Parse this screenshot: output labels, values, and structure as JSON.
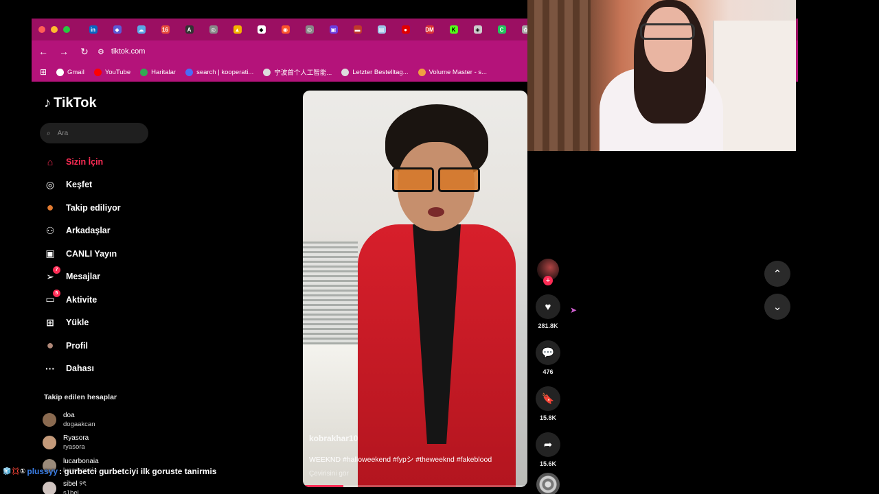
{
  "browser": {
    "url": "tiktok.com",
    "traffic_colors": [
      "#ff5f57",
      "#febc2e",
      "#28c840"
    ],
    "tab_favicons": [
      {
        "name": "linkedin-tab-icon",
        "color": "#0a66c2",
        "glyph": "in"
      },
      {
        "name": "app-tab-icon",
        "color": "#5b5bd6",
        "glyph": "◆"
      },
      {
        "name": "cloud-tab-icon",
        "color": "#5aa9e6",
        "glyph": "☁"
      },
      {
        "name": "calendar-tab-icon",
        "color": "#e74c3c",
        "glyph": "16"
      },
      {
        "name": "font-tab-icon",
        "color": "#333333",
        "glyph": "A"
      },
      {
        "name": "globe-tab-icon",
        "color": "#888888",
        "glyph": "◎"
      },
      {
        "name": "drive-tab-icon",
        "color": "#f4b400",
        "glyph": "▲"
      },
      {
        "name": "notion-tab-icon",
        "color": "#ffffff",
        "glyph": "◆"
      },
      {
        "name": "brave-tab-icon",
        "color": "#fb542b",
        "glyph": "◉"
      },
      {
        "name": "globe-tab-icon",
        "color": "#888888",
        "glyph": "◎"
      },
      {
        "name": "app-tab-icon",
        "color": "#6c3ce0",
        "glyph": "▣"
      },
      {
        "name": "flag-tab-icon",
        "color": "#c0392b",
        "glyph": "▬"
      },
      {
        "name": "doc-tab-icon",
        "color": "#9fc5e8",
        "glyph": "▤"
      },
      {
        "name": "pin-tab-icon",
        "color": "#e00000",
        "glyph": "●"
      },
      {
        "name": "dm-tab-icon",
        "color": "#d33",
        "glyph": "DM"
      },
      {
        "name": "kick-tab-icon",
        "color": "#53fc18",
        "glyph": "K"
      },
      {
        "name": "app-tab-icon",
        "color": "#cccccc",
        "glyph": "◈"
      },
      {
        "name": "app-tab-icon",
        "color": "#22c55e",
        "glyph": "C"
      },
      {
        "name": "openai-tab-icon",
        "color": "#aaaaaa",
        "glyph": "✿"
      }
    ],
    "bookmarks": [
      {
        "label": "Gmail",
        "icon": "google-icon",
        "color": "#ffffff"
      },
      {
        "label": "YouTube",
        "icon": "youtube-icon",
        "color": "#ff0000"
      },
      {
        "label": "Haritalar",
        "icon": "maps-icon",
        "color": "#34a853"
      },
      {
        "label": "search | kooperati...",
        "icon": "search-bookmark-icon",
        "color": "#4a6cf7"
      },
      {
        "label": "宁波首个人工智能...",
        "icon": "globe-icon",
        "color": "#dddddd"
      },
      {
        "label": "Letzter Bestelltag...",
        "icon": "globe-icon",
        "color": "#dddddd"
      },
      {
        "label": "Volume Master - s...",
        "icon": "volume-master-icon",
        "color": "#f0a040"
      }
    ]
  },
  "tiktok": {
    "brand": "TikTok",
    "search_placeholder": "Ara",
    "nav": [
      {
        "label": "Sizin İçin",
        "icon": "home-icon",
        "glyph": "⌂",
        "active": true,
        "badge": ""
      },
      {
        "label": "Keşfet",
        "icon": "compass-icon",
        "glyph": "◎",
        "active": false,
        "badge": ""
      },
      {
        "label": "Takip ediliyor",
        "icon": "following-avatar-icon",
        "glyph": "●",
        "active": false,
        "badge": ""
      },
      {
        "label": "Arkadaşlar",
        "icon": "friends-icon",
        "glyph": "⚇",
        "active": false,
        "badge": ""
      },
      {
        "label": "CANLI Yayın",
        "icon": "live-tv-icon",
        "glyph": "▣",
        "active": false,
        "badge": ""
      },
      {
        "label": "Mesajlar",
        "icon": "send-icon",
        "glyph": "➢",
        "active": false,
        "badge": "7"
      },
      {
        "label": "Aktivite",
        "icon": "activity-icon",
        "glyph": "▭",
        "active": false,
        "badge": "5"
      },
      {
        "label": "Yükle",
        "icon": "upload-plus-icon",
        "glyph": "⊞",
        "active": false,
        "badge": ""
      },
      {
        "label": "Profil",
        "icon": "profile-avatar-icon",
        "glyph": "●",
        "active": false,
        "badge": ""
      },
      {
        "label": "Dahası",
        "icon": "more-dots-icon",
        "glyph": "···",
        "active": false,
        "badge": ""
      }
    ],
    "following_title": "Takip edilen hesaplar",
    "following": [
      {
        "name": "doa",
        "handle": "dogaakcan",
        "color": "#8a6a50"
      },
      {
        "name": "Ryasora",
        "handle": "ryasora",
        "color": "#c49a7a"
      },
      {
        "name": "lucarbonaia",
        "handle": "lucarbonaia",
        "color": "#9a8a7a"
      },
      {
        "name": "sibel ୨ৎ",
        "handle": "s1bel",
        "color": "#d0c4c0"
      }
    ],
    "video": {
      "username": "kobrakhar10",
      "caption": "WEEKND #halloweekend #fypシ #theweeknd #fakeblood",
      "translate": "Çevirisini gör",
      "progress": 0.18
    },
    "actions": {
      "likes": "281.8K",
      "comments": "476",
      "saves": "15.8K",
      "shares": "15.6K"
    }
  },
  "chat": {
    "badges": "🧊💢①",
    "user": "plussyy",
    "message": ": gurbetci gurbetciyi ilk goruste tanirmis"
  }
}
